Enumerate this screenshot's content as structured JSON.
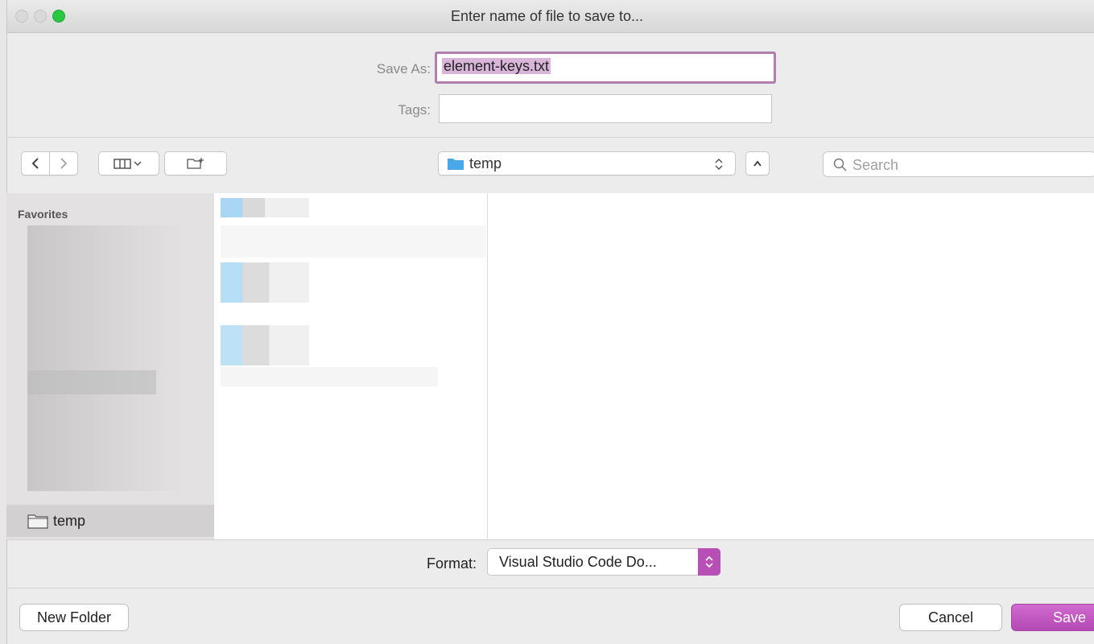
{
  "window": {
    "title": "Enter name of file to save to..."
  },
  "save_as": {
    "label": "Save As:",
    "value": "element-keys.txt"
  },
  "tags": {
    "label": "Tags:",
    "value": ""
  },
  "toolbar": {
    "back_icon": "chevron-left-icon",
    "forward_icon": "chevron-right-icon",
    "view_icon": "column-view-icon",
    "new_folder_icon": "folder-plus-icon",
    "location": "temp",
    "search_placeholder": "Search"
  },
  "sidebar": {
    "section_title": "Favorites",
    "selected_item": "temp"
  },
  "format": {
    "label": "Format:",
    "value": "Visual Studio Code Do..."
  },
  "buttons": {
    "new_folder": "New Folder",
    "cancel": "Cancel",
    "save": "Save"
  },
  "colors": {
    "accent": "#b74fb7",
    "highlight": "#d9b6d9",
    "folder_blue": "#4aa8e8"
  }
}
